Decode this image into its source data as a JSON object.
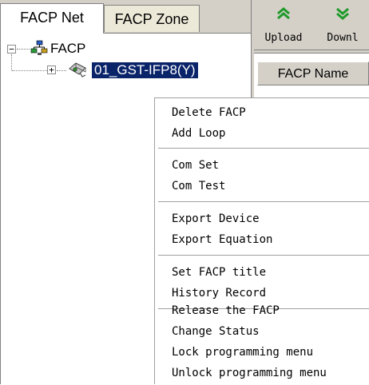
{
  "tabs": [
    {
      "label": "FACP Net",
      "active": true
    },
    {
      "label": "FACP Zone",
      "active": false
    }
  ],
  "tree": {
    "root": {
      "label": "FACP",
      "expander": "−",
      "icon": "network-icon"
    },
    "child": {
      "label": "01_GST-IFP8(Y)",
      "expander": "+",
      "icon": "fire-panel-icon",
      "selected": true
    }
  },
  "toolbar": {
    "upload_label": "Upload",
    "download_label": "Downl"
  },
  "grid": {
    "column_header": "FACP Name"
  },
  "context_menu": {
    "groups": [
      [
        "Delete FACP",
        "Add Loop"
      ],
      [
        "Com Set",
        "Com Test"
      ],
      [
        "Export Device",
        "Export Equation"
      ],
      [
        "Set FACP title",
        "History Record"
      ],
      [
        "Release the FACP",
        "Change Status",
        "Lock programming menu",
        "Unlock programming menu"
      ]
    ]
  },
  "colors": {
    "selection": "#0a246a",
    "chrome": "#d4d0c8",
    "arrow_green": "#1f9a2a"
  }
}
